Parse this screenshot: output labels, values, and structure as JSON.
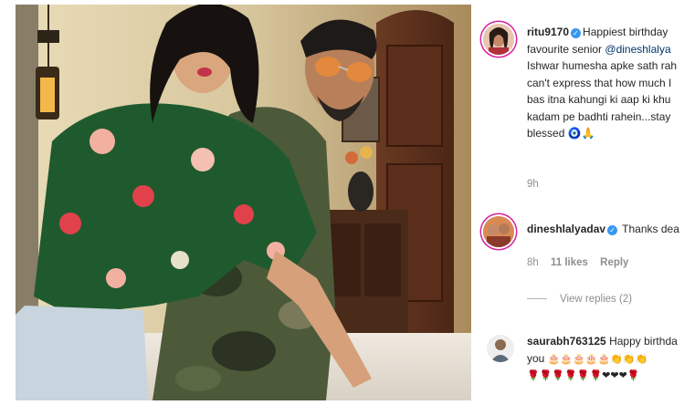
{
  "comments": [
    {
      "username": "ritu9170",
      "verified": true,
      "lines": [
        "Happiest birthday",
        "favourite senior",
        "Ishwar humesha apke sath rah",
        "can't express that how much I",
        "bas itna kahungi ki aap ki khu",
        "kadam pe badhti rahein...stay",
        "blessed"
      ],
      "mention": "@dineshlalya",
      "trailing_emoji": "🧿🙏",
      "time": "9h"
    },
    {
      "username": "dineshlalyadav",
      "verified": true,
      "text": "Thanks dea",
      "time": "8h",
      "likes": "11 likes",
      "reply_label": "Reply",
      "view_replies": "View replies (2)"
    },
    {
      "username": "saurabh763125",
      "verified": false,
      "text": "Happy birthda",
      "line2_prefix": "you",
      "line2_emoji": "🎂🎂🎂🎂🎂👏👏👏",
      "line3_emoji": "🌹🌹🌹🌹🌹🌹❤❤❤🌹"
    }
  ],
  "icons": {
    "verified": "verified-check-icon"
  },
  "colors": {
    "username": "#262626",
    "meta": "#8e8e8e",
    "mention": "#003569",
    "verified": "#3897f0",
    "story_ring": "#d6249f"
  }
}
